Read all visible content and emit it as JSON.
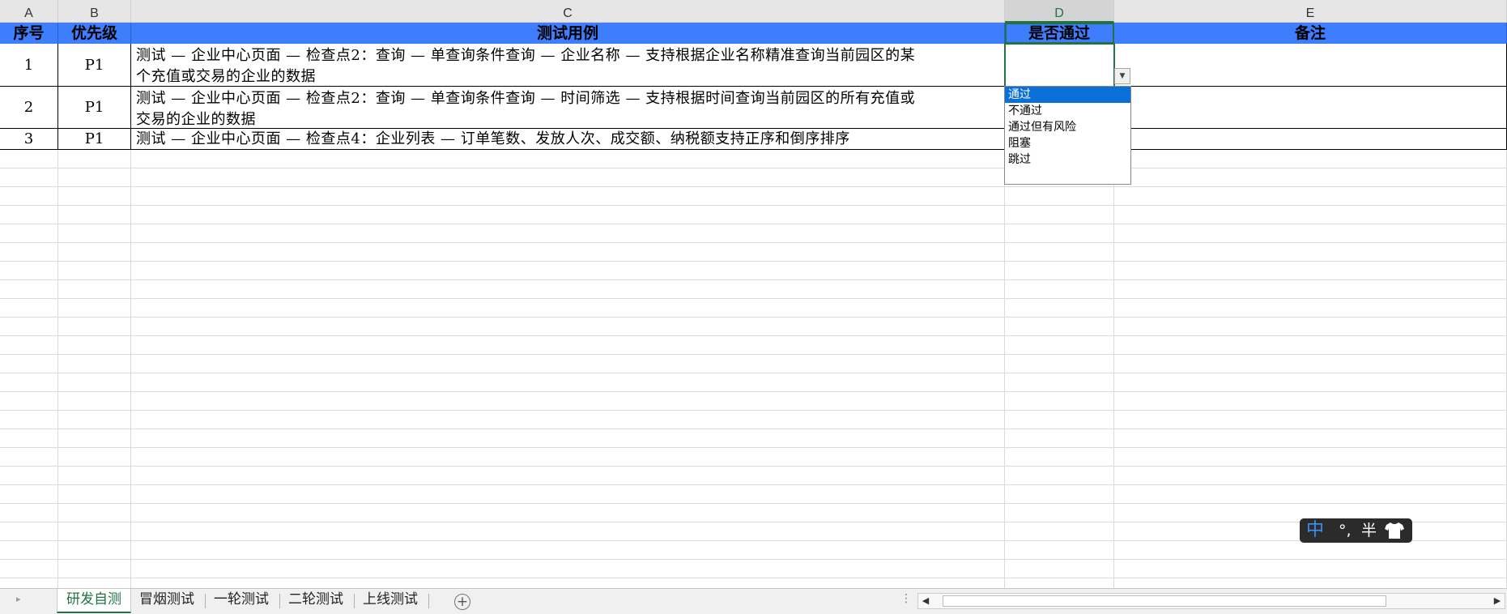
{
  "columns": [
    "A",
    "B",
    "C",
    "D",
    "E"
  ],
  "header": {
    "seq": "序号",
    "priority": "优先级",
    "testcase": "测试用例",
    "passed": "是否通过",
    "remark": "备注"
  },
  "rows": [
    {
      "seq": "1",
      "priority": "P1",
      "testcase_line1": "测试 — 企业中心页面 — 检查点2：查询 — 单查询条件查询 — 企业名称 — 支持根据企业名称精准查询当前园区的某",
      "testcase_line2": "个充值或交易的企业的数据"
    },
    {
      "seq": "2",
      "priority": "P1",
      "testcase_line1": "测试 — 企业中心页面 — 检查点2：查询 — 单查询条件查询 — 时间筛选 — 支持根据时间查询当前园区的所有充值或",
      "testcase_line2": "交易的企业的数据"
    },
    {
      "seq": "3",
      "priority": "P1",
      "testcase_line1": "测试 — 企业中心页面 — 检查点4：企业列表 — 订单笔数、发放人次、成交额、纳税额支持正序和倒序排序",
      "testcase_line2": ""
    }
  ],
  "dropdown": {
    "options": [
      "通过",
      "不通过",
      "通过但有风险",
      "阻塞",
      "跳过"
    ],
    "highlighted": "通过",
    "arrow_icon": "dropdown-arrow-icon"
  },
  "ime": {
    "mode": "中",
    "punct": "°,",
    "width": "半",
    "skin_icon": "tshirt-icon"
  },
  "sheet_tabs": [
    "研发自测",
    "冒烟测试",
    "一轮测试",
    "二轮测试",
    "上线测试"
  ],
  "active_tab": "研发自测",
  "colors": {
    "header_bg": "#3e7dfb",
    "accent": "#217346",
    "dropdown_highlight": "#0a6fd6"
  }
}
